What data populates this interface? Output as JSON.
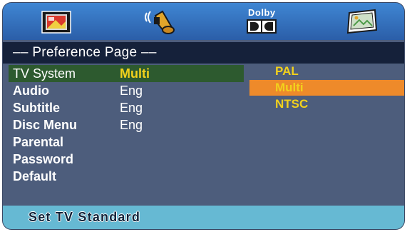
{
  "icon_bar": {
    "icons": [
      "tv-display-icon",
      "speaker-audio-icon",
      "dolby-icon",
      "preference-picture-icon"
    ],
    "dolby_label": "Dolby"
  },
  "page": {
    "title": "–– Preference Page ––"
  },
  "menu": {
    "items": [
      {
        "label": "TV System",
        "value": "Multi"
      },
      {
        "label": "Audio",
        "value": "Eng"
      },
      {
        "label": "Subtitle",
        "value": "Eng"
      },
      {
        "label": "Disc Menu",
        "value": "Eng"
      },
      {
        "label": "Parental",
        "value": ""
      },
      {
        "label": "Password",
        "value": ""
      },
      {
        "label": "Default",
        "value": ""
      }
    ],
    "selected_index": 0
  },
  "options": {
    "items": [
      "PAL",
      "Multi",
      "NTSC"
    ],
    "highlighted_index": 1
  },
  "status": {
    "text": "Set TV Standard"
  },
  "colors": {
    "icon_bar": "#3f86d3",
    "panel": "#4d5d7c",
    "selected_row": "#2d5a2f",
    "option_highlight": "#ee8a2a",
    "option_text": "#f2d11c",
    "status_bar": "#66b9d3"
  }
}
